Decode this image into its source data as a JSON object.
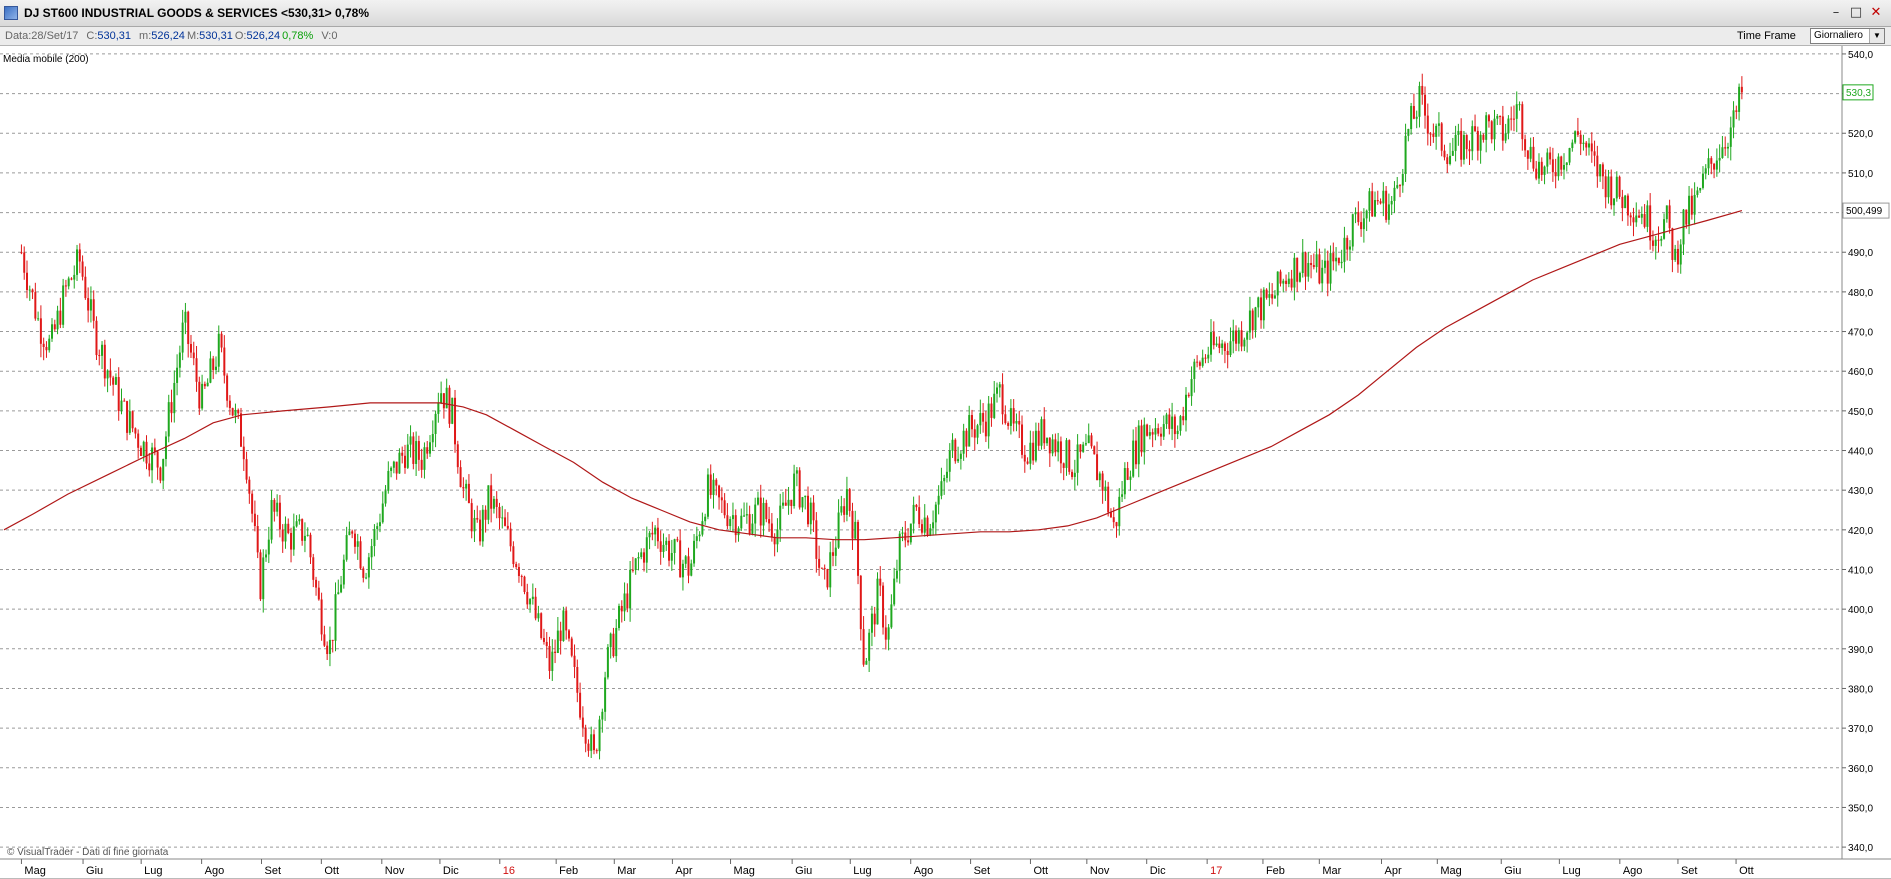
{
  "window": {
    "title": "DJ ST600 INDUSTRIAL GOODS & SERVICES <530,31> 0,78%",
    "controls": {
      "minimize": "–",
      "restore": "□",
      "close": "✕"
    }
  },
  "infobar": {
    "date_label": "Data:",
    "date": "28/Set/17",
    "close_label": "C:",
    "close": "530,31",
    "min_label": "m:",
    "min": "526,24",
    "max_label": "M:",
    "max": "530,31",
    "open_label": "O:",
    "open": "526,24",
    "change": "0,78%",
    "volume_label": "V:",
    "volume": "0",
    "timeframe_label": "Time Frame",
    "timeframe_value": "Giornaliero"
  },
  "colors": {
    "up": "#1fa81f",
    "down": "#e01818",
    "moving_average": "#b01818",
    "grid": "#9a9a9a",
    "last_price_tag": "#1fa81f"
  },
  "chart_data": {
    "type": "candlestick",
    "indicator_label": "Media mobile (200)",
    "watermark": "© VisualTrader - Dati di fine giornata",
    "ylim": [
      337,
      542
    ],
    "yticks": [
      "540,0",
      "530,0",
      "520,0",
      "510,0",
      "500,0",
      "490,0",
      "480,0",
      "470,0",
      "460,0",
      "450,0",
      "440,0",
      "430,0",
      "420,0",
      "410,0",
      "400,0",
      "390,0",
      "380,0",
      "370,0",
      "360,0",
      "350,0",
      "340,0"
    ],
    "x_ticks": [
      "Mag",
      "Giu",
      "Lug",
      "Ago",
      "Set",
      "Ott",
      "Nov",
      "Dic",
      "16",
      "Feb",
      "Mar",
      "Apr",
      "Mag",
      "Giu",
      "Lug",
      "Ago",
      "Set",
      "Ott",
      "Nov",
      "Dic",
      "17",
      "Feb",
      "Mar",
      "Apr",
      "Mag",
      "Giu",
      "Lug",
      "Ago",
      "Set",
      "Ott"
    ],
    "x_tick_positions": [
      0,
      1.06,
      2.06,
      3.1,
      4.13,
      5.16,
      6.2,
      7.2,
      8.23,
      9.2,
      10.2,
      11.2,
      12.2,
      13.26,
      14.26,
      15.3,
      16.33,
      17.36,
      18.33,
      19.36,
      20.4,
      21.36,
      22.33,
      23.4,
      24.36,
      25.46,
      26.46,
      27.5,
      28.5,
      29.5
    ],
    "x_range": [
      -0.3,
      30.6
    ],
    "path": [
      [
        0,
        490
      ],
      [
        0.3,
        472
      ],
      [
        0.5,
        466
      ],
      [
        0.75,
        480
      ],
      [
        1,
        488
      ],
      [
        1.25,
        470
      ],
      [
        1.5,
        460
      ],
      [
        1.75,
        450
      ],
      [
        2.05,
        442
      ],
      [
        2.4,
        436
      ],
      [
        2.55,
        450
      ],
      [
        2.8,
        472
      ],
      [
        3.1,
        452
      ],
      [
        3.4,
        466
      ],
      [
        3.6,
        452
      ],
      [
        3.85,
        440
      ],
      [
        4.0,
        420
      ],
      [
        4.1,
        405
      ],
      [
        4.3,
        425
      ],
      [
        4.6,
        418
      ],
      [
        4.9,
        420
      ],
      [
        5.1,
        402
      ],
      [
        5.3,
        390
      ],
      [
        5.5,
        408
      ],
      [
        5.7,
        422
      ],
      [
        5.9,
        410
      ],
      [
        6.1,
        420
      ],
      [
        6.3,
        432
      ],
      [
        6.6,
        440
      ],
      [
        6.9,
        438
      ],
      [
        7.2,
        456
      ],
      [
        7.4,
        450
      ],
      [
        7.6,
        430
      ],
      [
        7.85,
        418
      ],
      [
        8.05,
        428
      ],
      [
        8.3,
        420
      ],
      [
        8.6,
        410
      ],
      [
        8.9,
        395
      ],
      [
        9.1,
        385
      ],
      [
        9.3,
        397
      ],
      [
        9.55,
        380
      ],
      [
        9.85,
        362
      ],
      [
        10.05,
        385
      ],
      [
        10.3,
        398
      ],
      [
        10.6,
        412
      ],
      [
        10.9,
        420
      ],
      [
        11.15,
        415
      ],
      [
        11.5,
        410
      ],
      [
        11.8,
        430
      ],
      [
        12.1,
        425
      ],
      [
        12.4,
        422
      ],
      [
        12.7,
        425
      ],
      [
        13.0,
        420
      ],
      [
        13.3,
        432
      ],
      [
        13.55,
        425
      ],
      [
        13.8,
        405
      ],
      [
        14.05,
        420
      ],
      [
        14.2,
        430
      ],
      [
        14.35,
        418
      ],
      [
        14.5,
        386
      ],
      [
        14.75,
        405
      ],
      [
        14.9,
        392
      ],
      [
        15.1,
        415
      ],
      [
        15.4,
        425
      ],
      [
        15.6,
        422
      ],
      [
        15.85,
        430
      ],
      [
        16.0,
        440
      ],
      [
        16.3,
        445
      ],
      [
        16.6,
        448
      ],
      [
        16.85,
        455
      ],
      [
        17.05,
        445
      ],
      [
        17.3,
        440
      ],
      [
        17.6,
        445
      ],
      [
        17.9,
        440
      ],
      [
        18.1,
        436
      ],
      [
        18.35,
        440
      ],
      [
        18.6,
        432
      ],
      [
        18.8,
        420
      ],
      [
        19.0,
        435
      ],
      [
        19.3,
        445
      ],
      [
        19.6,
        447
      ],
      [
        19.9,
        445
      ],
      [
        20.1,
        458
      ],
      [
        20.4,
        465
      ],
      [
        20.7,
        467
      ],
      [
        21.0,
        470
      ],
      [
        21.2,
        475
      ],
      [
        21.5,
        478
      ],
      [
        21.8,
        485
      ],
      [
        22.1,
        488
      ],
      [
        22.4,
        484
      ],
      [
        22.7,
        490
      ],
      [
        22.9,
        497
      ],
      [
        23.3,
        503
      ],
      [
        23.6,
        502
      ],
      [
        23.85,
        520
      ],
      [
        24.05,
        528
      ],
      [
        24.3,
        520
      ],
      [
        24.6,
        515
      ],
      [
        24.9,
        518
      ],
      [
        25.2,
        522
      ],
      [
        25.5,
        520
      ],
      [
        25.75,
        527
      ],
      [
        25.95,
        515
      ],
      [
        26.2,
        510
      ],
      [
        26.55,
        515
      ],
      [
        26.8,
        520
      ],
      [
        27.05,
        512
      ],
      [
        27.3,
        507
      ],
      [
        27.6,
        503
      ],
      [
        27.9,
        500
      ],
      [
        28.1,
        495
      ],
      [
        28.3,
        498
      ],
      [
        28.45,
        488
      ],
      [
        28.6,
        498
      ],
      [
        28.8,
        502
      ],
      [
        29.0,
        510
      ],
      [
        29.2,
        516
      ],
      [
        29.45,
        522
      ],
      [
        29.6,
        530.31
      ]
    ],
    "moving_average": [
      [
        -0.3,
        420
      ],
      [
        0.2,
        424
      ],
      [
        0.8,
        429
      ],
      [
        1.5,
        434
      ],
      [
        2.2,
        439
      ],
      [
        2.8,
        443
      ],
      [
        3.3,
        447
      ],
      [
        3.8,
        449
      ],
      [
        4.5,
        450
      ],
      [
        5.3,
        451
      ],
      [
        6.0,
        452
      ],
      [
        6.6,
        452
      ],
      [
        7.2,
        452
      ],
      [
        7.6,
        451
      ],
      [
        8.0,
        449
      ],
      [
        8.5,
        445
      ],
      [
        9.0,
        441
      ],
      [
        9.5,
        437
      ],
      [
        10.0,
        432
      ],
      [
        10.5,
        428
      ],
      [
        11.0,
        425
      ],
      [
        11.5,
        422
      ],
      [
        12.0,
        420
      ],
      [
        12.5,
        419
      ],
      [
        13.0,
        418
      ],
      [
        13.5,
        418
      ],
      [
        14.0,
        417.5
      ],
      [
        14.5,
        417.5
      ],
      [
        15.0,
        418
      ],
      [
        15.5,
        418.5
      ],
      [
        16.0,
        419
      ],
      [
        16.5,
        419.5
      ],
      [
        17.0,
        419.5
      ],
      [
        17.5,
        420
      ],
      [
        18.0,
        421
      ],
      [
        18.5,
        423
      ],
      [
        19.0,
        426
      ],
      [
        19.5,
        429
      ],
      [
        20.0,
        432
      ],
      [
        20.5,
        435
      ],
      [
        21.0,
        438
      ],
      [
        21.5,
        441
      ],
      [
        22.0,
        445
      ],
      [
        22.5,
        449
      ],
      [
        23.0,
        454
      ],
      [
        23.5,
        460
      ],
      [
        24.0,
        466
      ],
      [
        24.5,
        471
      ],
      [
        25.0,
        475
      ],
      [
        25.5,
        479
      ],
      [
        26.0,
        483
      ],
      [
        26.5,
        486
      ],
      [
        27.0,
        489
      ],
      [
        27.5,
        492
      ],
      [
        28.0,
        494
      ],
      [
        28.5,
        496
      ],
      [
        29.0,
        498
      ],
      [
        29.6,
        500.5
      ]
    ],
    "last_price_label": "530,3",
    "ma_value_label": "500,499"
  }
}
